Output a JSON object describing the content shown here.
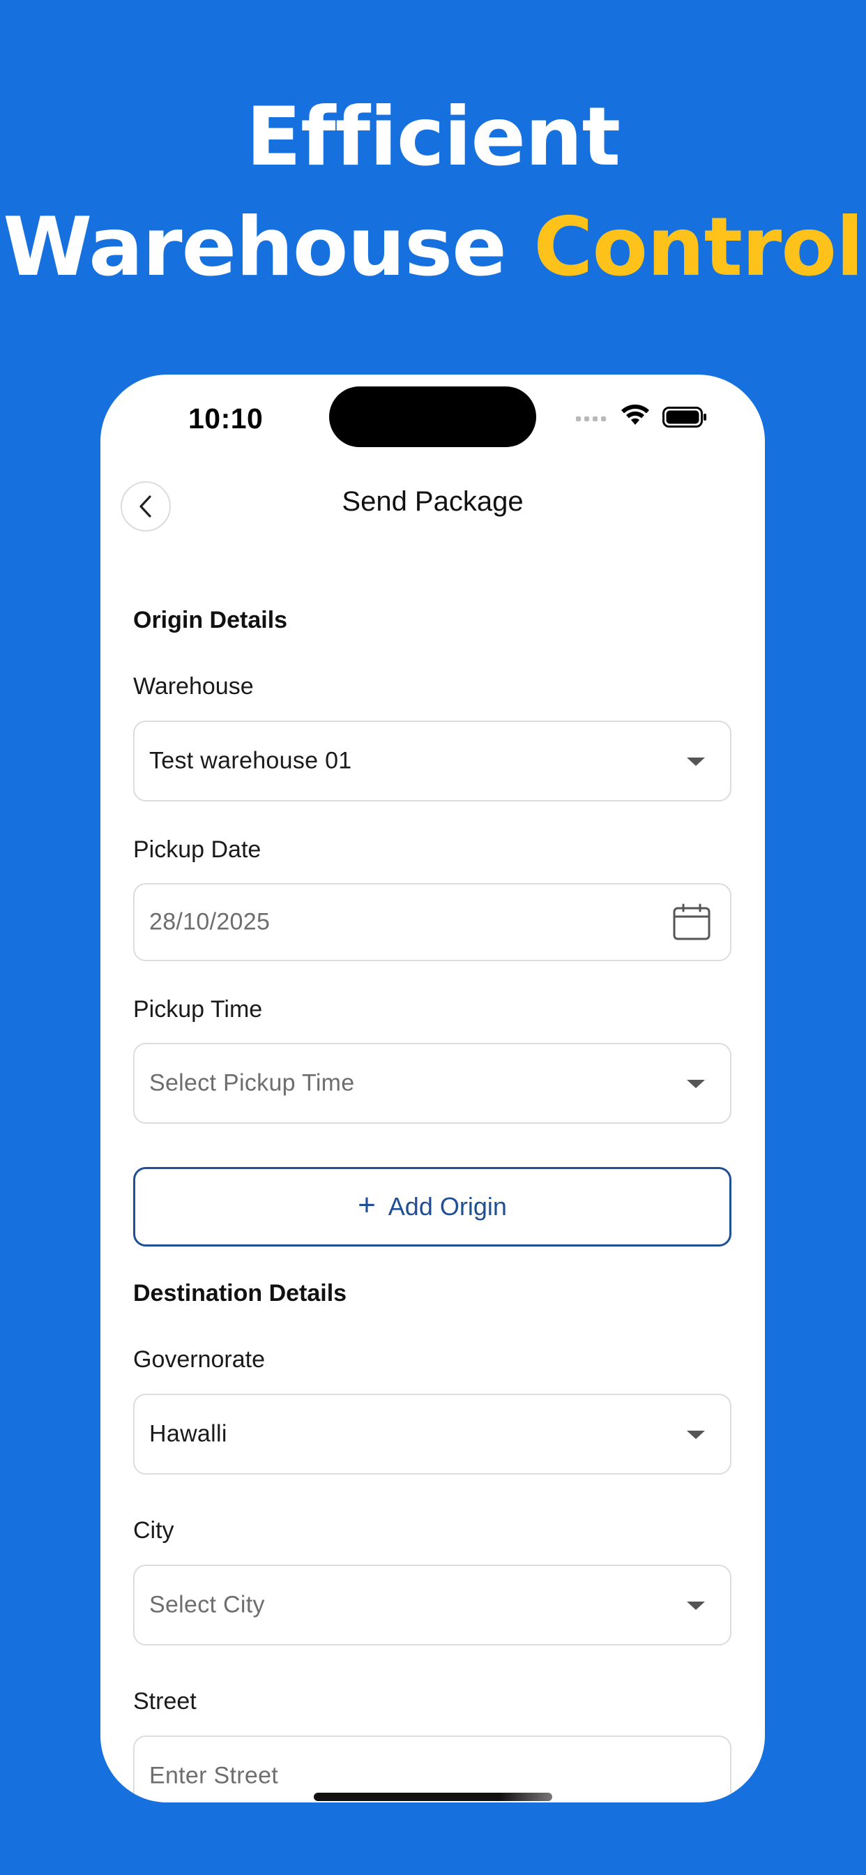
{
  "headline": {
    "line1": "Efficient",
    "line2_main": "Warehouse",
    "line2_accent": "Control"
  },
  "colors": {
    "background": "#1670dd",
    "accent": "#ffc21a",
    "primary_button": "#1f4f94"
  },
  "status_bar": {
    "time": "10:10",
    "icons": [
      "signal-icon",
      "wifi-icon",
      "battery-icon"
    ]
  },
  "nav": {
    "back_icon": "chevron-left-icon",
    "title": "Send Package"
  },
  "origin": {
    "section_title": "Origin Details",
    "warehouse": {
      "label": "Warehouse",
      "value": "Test warehouse 01"
    },
    "pickup_date": {
      "label": "Pickup Date",
      "value": "28/10/2025",
      "icon": "calendar-icon"
    },
    "pickup_time": {
      "label": "Pickup Time",
      "placeholder": "Select Pickup Time"
    },
    "add_button": {
      "icon": "plus-icon",
      "label": "Add Origin"
    }
  },
  "destination": {
    "section_title": "Destination Details",
    "governorate": {
      "label": "Governorate",
      "value": "Hawalli"
    },
    "city": {
      "label": "City",
      "placeholder": "Select City"
    },
    "street": {
      "label": "Street",
      "placeholder": "Enter Street"
    }
  }
}
